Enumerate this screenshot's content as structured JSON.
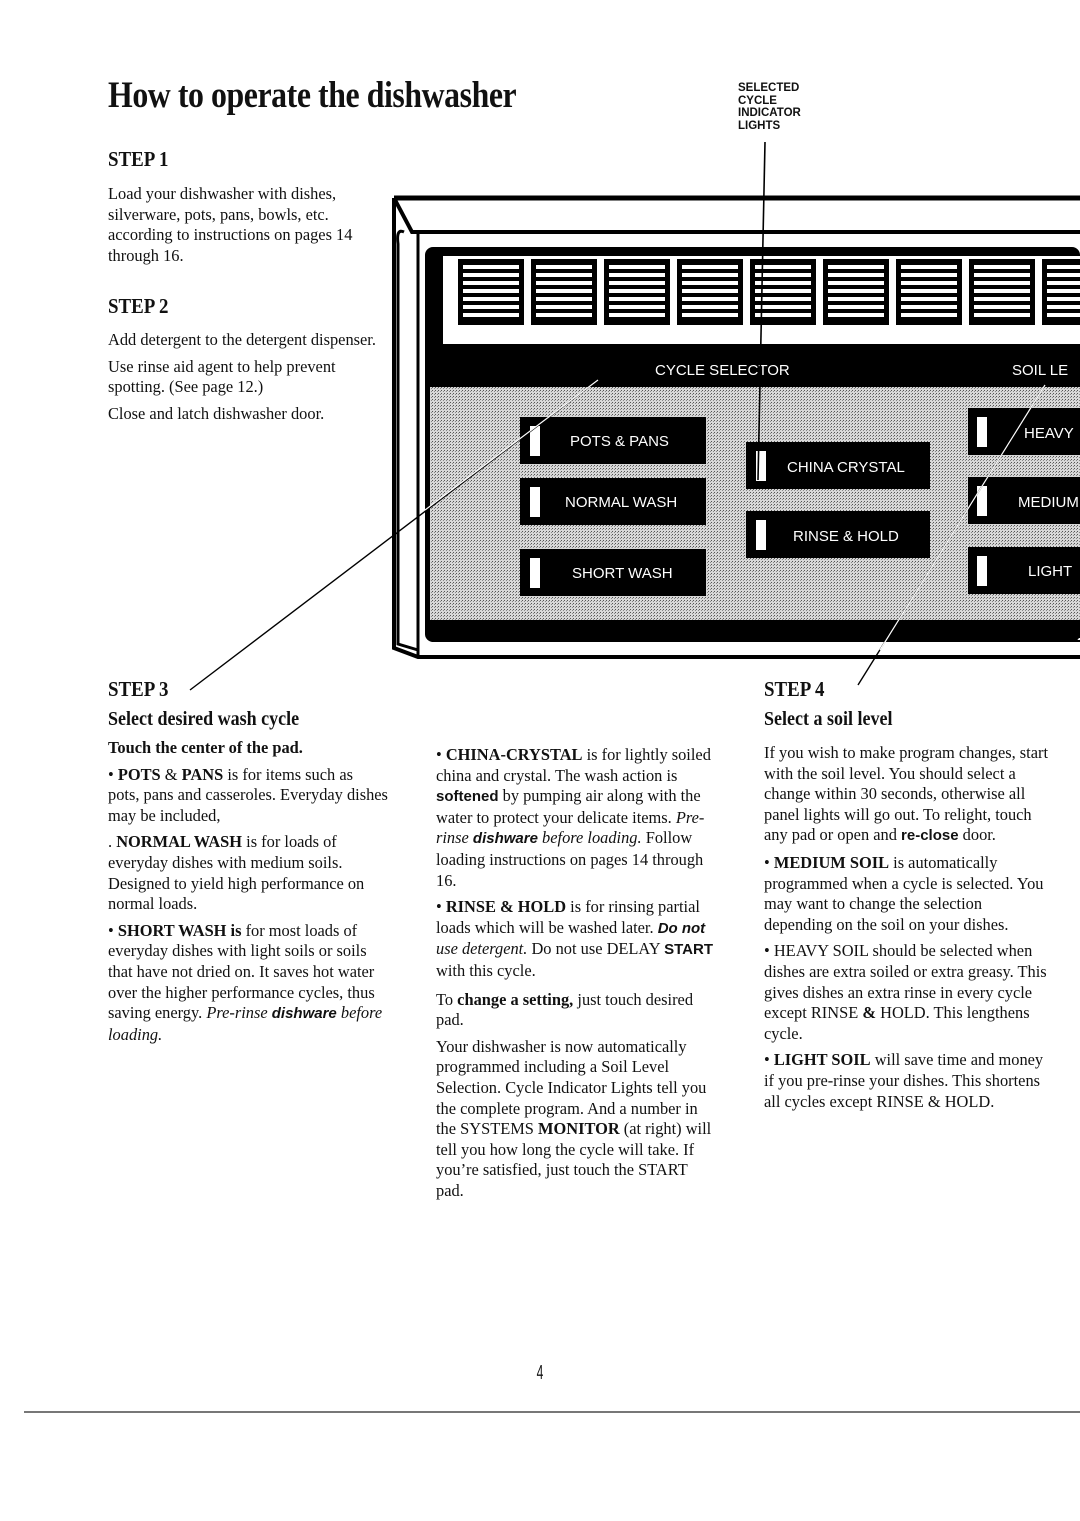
{
  "page": {
    "title": "How to operate the dishwasher",
    "page_number": "4"
  },
  "callout": {
    "lines": [
      "SELECTED",
      "CYCLE",
      "INDICATOR",
      "LIGHTS"
    ]
  },
  "step1": {
    "heading": "STEP 1",
    "text": "Load your dishwasher with dishes, silverware, pots, pans, bowls, etc. according to instructions on pages 14 through 16."
  },
  "step2": {
    "heading": "STEP 2",
    "paragraphs": [
      "Add detergent to the detergent dispenser.",
      "Use rinse aid agent to help prevent spotting. (See page 12.)",
      "Close and latch dishwasher door."
    ]
  },
  "step3": {
    "heading": "STEP 3",
    "subheading": "Select desired wash cycle",
    "instruction": "Touch the center of the pad.",
    "pots": {
      "label_a": "POTS",
      "amp": "&",
      "label_b": "PANS",
      "text": "is for items such as pots, pans and casseroles. Everyday dishes may be included,"
    },
    "normal": {
      "label": "NORMAL WASH",
      "text": "is for loads of everyday dishes with medium soils. Designed to yield high performance on normal loads."
    },
    "short": {
      "label": "SHORT WASH is",
      "text": "for most loads of everyday dishes with light soils or soils that have not dried on. It saves hot water over the higher performance cycles, thus saving energy.",
      "italic_a": "Pre-rinse",
      "bold_italic": "dishware",
      "italic_b": "before loading."
    }
  },
  "middle": {
    "china": {
      "label": "CHINA-CRYSTAL",
      "text_a": "is for lightly soiled china and crystal. The wash action is",
      "bold": "softened",
      "text_b": "by pumping air along with the water to protect your delicate items.",
      "italic_a": "Pre-rinse",
      "bold_italic": "dishware",
      "italic_b": "before loading.",
      "text_c": "Follow loading instructions on pages 14 through 16."
    },
    "rinse": {
      "label": "RINSE & HOLD",
      "text_a": "is for rinsing partial loads which will be washed later.",
      "bold_italic": "Do not",
      "italic": "use detergent.",
      "text_b": "Do not use DELAY",
      "bold": "START",
      "text_c": "with this cycle."
    },
    "change": {
      "text_a": "To",
      "bold": "change a setting,",
      "text_b": "just touch desired pad."
    },
    "program": {
      "text_a": "Your dishwasher is now automatically programmed including a Soil Level Selection. Cycle Indicator Lights tell you the complete program. And a number in the SYSTEMS",
      "bold": "MONITOR",
      "text_b": "(at right) will tell you how long the cycle will take. If you’re satisfied, just touch the START pad."
    }
  },
  "step4": {
    "heading": "STEP 4",
    "subheading": "Select a soil level",
    "intro_a": "If you wish to make program changes, start with the soil level. You should select a change within 30 seconds, otherwise all panel lights will go out. To relight, touch any pad or open and",
    "intro_bold": "re-close",
    "intro_b": "door.",
    "medium": {
      "label": "MEDIUM SOIL",
      "text": "is automatically programmed when a cycle is selected. You may want to change the selection depending on the soil on your dishes."
    },
    "heavy": {
      "label": "HEAVY SOIL",
      "text_a": "should be selected when dishes are extra soiled or extra greasy. This gives dishes an extra rinse in every cycle except RINSE",
      "amp": "&",
      "text_b": "HOLD. This lengthens cycle."
    },
    "light": {
      "label": "LIGHT SOIL",
      "text": "will save time and money if you pre-rinse your dishes. This shortens all cycles except RINSE & HOLD."
    }
  },
  "panel": {
    "cycle_selector_label": "CYCLE SELECTOR",
    "soil_level_label": "SOIL LE",
    "pads": {
      "pots_pans": "POTS & PANS",
      "normal_wash": "NORMAL WASH",
      "short_wash": "SHORT WASH",
      "china_crystal": "CHINA CRYSTAL",
      "rinse_hold": "RINSE & HOLD",
      "heavy": "HEAVY",
      "medium": "MEDIUM",
      "light": "LIGHT"
    },
    "colors": {
      "panel": "#000000",
      "face": "#b8b8b8",
      "light": "#ffffff"
    }
  }
}
